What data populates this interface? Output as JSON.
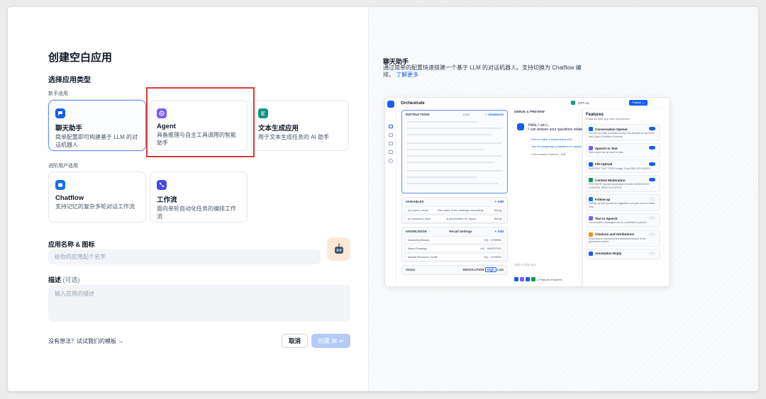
{
  "left": {
    "title": "创建空白应用",
    "type_heading": "选择应用类型",
    "beginner_label": "新手适用",
    "advanced_label": "进阶用户适用",
    "cards": [
      {
        "name": "聊天助手",
        "desc": "简单配置即可构建基于 LLM 的对话机器人",
        "color": "#155eef",
        "icon": "chat-bubble-icon"
      },
      {
        "name": "Agent",
        "desc": "具备推理与自主工具调用的智能助手",
        "color": "#7a5af8",
        "icon": "agent-robot-icon"
      },
      {
        "name": "文本生成应用",
        "desc": "用于文本生成任务的 AI 助手",
        "color": "#0e9384",
        "icon": "text-generation-icon"
      },
      {
        "name": "Chatflow",
        "desc": "支持记忆的复杂多轮对话工作流",
        "color": "#1570ef",
        "icon": "chatflow-icon"
      },
      {
        "name": "工作流",
        "desc": "面向单轮自动化任务的编排工作流",
        "color": "#444ce7",
        "icon": "workflow-icon"
      }
    ],
    "name_label": "应用名称 & 图标",
    "name_placeholder": "给你的应用起个名字",
    "desc_label": "描述",
    "desc_optional": "(可选)",
    "desc_placeholder": "输入应用的描述",
    "template_link": "没有想法？试试我们的模板 →",
    "cancel": "取消",
    "create": "创建 ⌘ ↵"
  },
  "right": {
    "title": "聊天助手",
    "desc": "通过简单的配置快速搭建一个基于 LLM 的对话机器人。支持切换为 Chatflow 编排。",
    "learn_more": "了解更多",
    "preview": {
      "orchestrate": "Orchestrate",
      "model": "GPT-4o",
      "publish": "Publish ⌄",
      "instructions": "INSTRUCTIONS",
      "instructions_count": "2183",
      "generate": "✧ GENERATE",
      "variables": "VARIABLES",
      "add": "+ Add",
      "variable_rows": [
        {
          "k": "{x} expert_name",
          "v": "The name of the strategic consulting...",
          "t": "String"
        },
        {
          "k": "{x} unsolved_topic",
          "v": "A placeholder for topics...",
          "t": "String"
        }
      ],
      "knowledge": "KNOWLEDGE",
      "recall": "Recall Settings",
      "knowledge_rows": [
        {
          "k": "Marketing Basics",
          "t": "HQ · HYBRID"
        },
        {
          "k": "Brand Strategy",
          "t": "HQ · INVERTED"
        },
        {
          "k": "Market Research Guide",
          "t": "HQ · HYBRID"
        }
      ],
      "vision": "Vision",
      "resolution": "RESOLUTION",
      "high": "High",
      "low": "Low",
      "debug": "DEBUG & PREVIEW",
      "hello": "Hello, I am L.",
      "hello2": "I can answer your questions related",
      "sug1": "How to make a brand stand out?",
      "sug2": "Tips for analyzing competitors in market",
      "opener": "Conversation Opener · Edit",
      "talk": "Talk to Dify Bot",
      "enabled": "4 Features Enabled",
      "features_title": "Features",
      "features_sub": "Enhance web app user experience",
      "features": [
        {
          "n": "Conversation Opener",
          "d": "You are an entity extraction model that accepts an input text and (Type) of entities to extract.",
          "on": true,
          "color": "#155eef"
        },
        {
          "n": "Speech to Text",
          "d": "Voice input can be used in chat.",
          "on": true,
          "color": "#7a5af8"
        },
        {
          "n": "File Upload",
          "d": "SUPPORT FILE TYPES Image, Docs   MAX UPLOADS 5",
          "on": true,
          "color": "#155eef"
        },
        {
          "n": "Content Moderation",
          "d": "PROVIDER OpenAI Moderation   ENABLE MODERATE CONTENT INPUT & OUTPUT",
          "on": true,
          "color": "#039855"
        },
        {
          "n": "Follow-up",
          "d": "Setting up next questions suggestion can give users a better chat.",
          "on": false,
          "color": "#1570ef"
        },
        {
          "n": "Text to Speech",
          "d": "Conversation messages can be converted to speech.",
          "on": false,
          "color": "#7a5af8"
        },
        {
          "n": "Citations and Attributions",
          "d": "Show source document and attributed section of the generated content.",
          "on": false,
          "color": "#f79009"
        },
        {
          "n": "Annotation Reply",
          "d": "",
          "on": false,
          "color": "#155eef"
        }
      ]
    }
  }
}
